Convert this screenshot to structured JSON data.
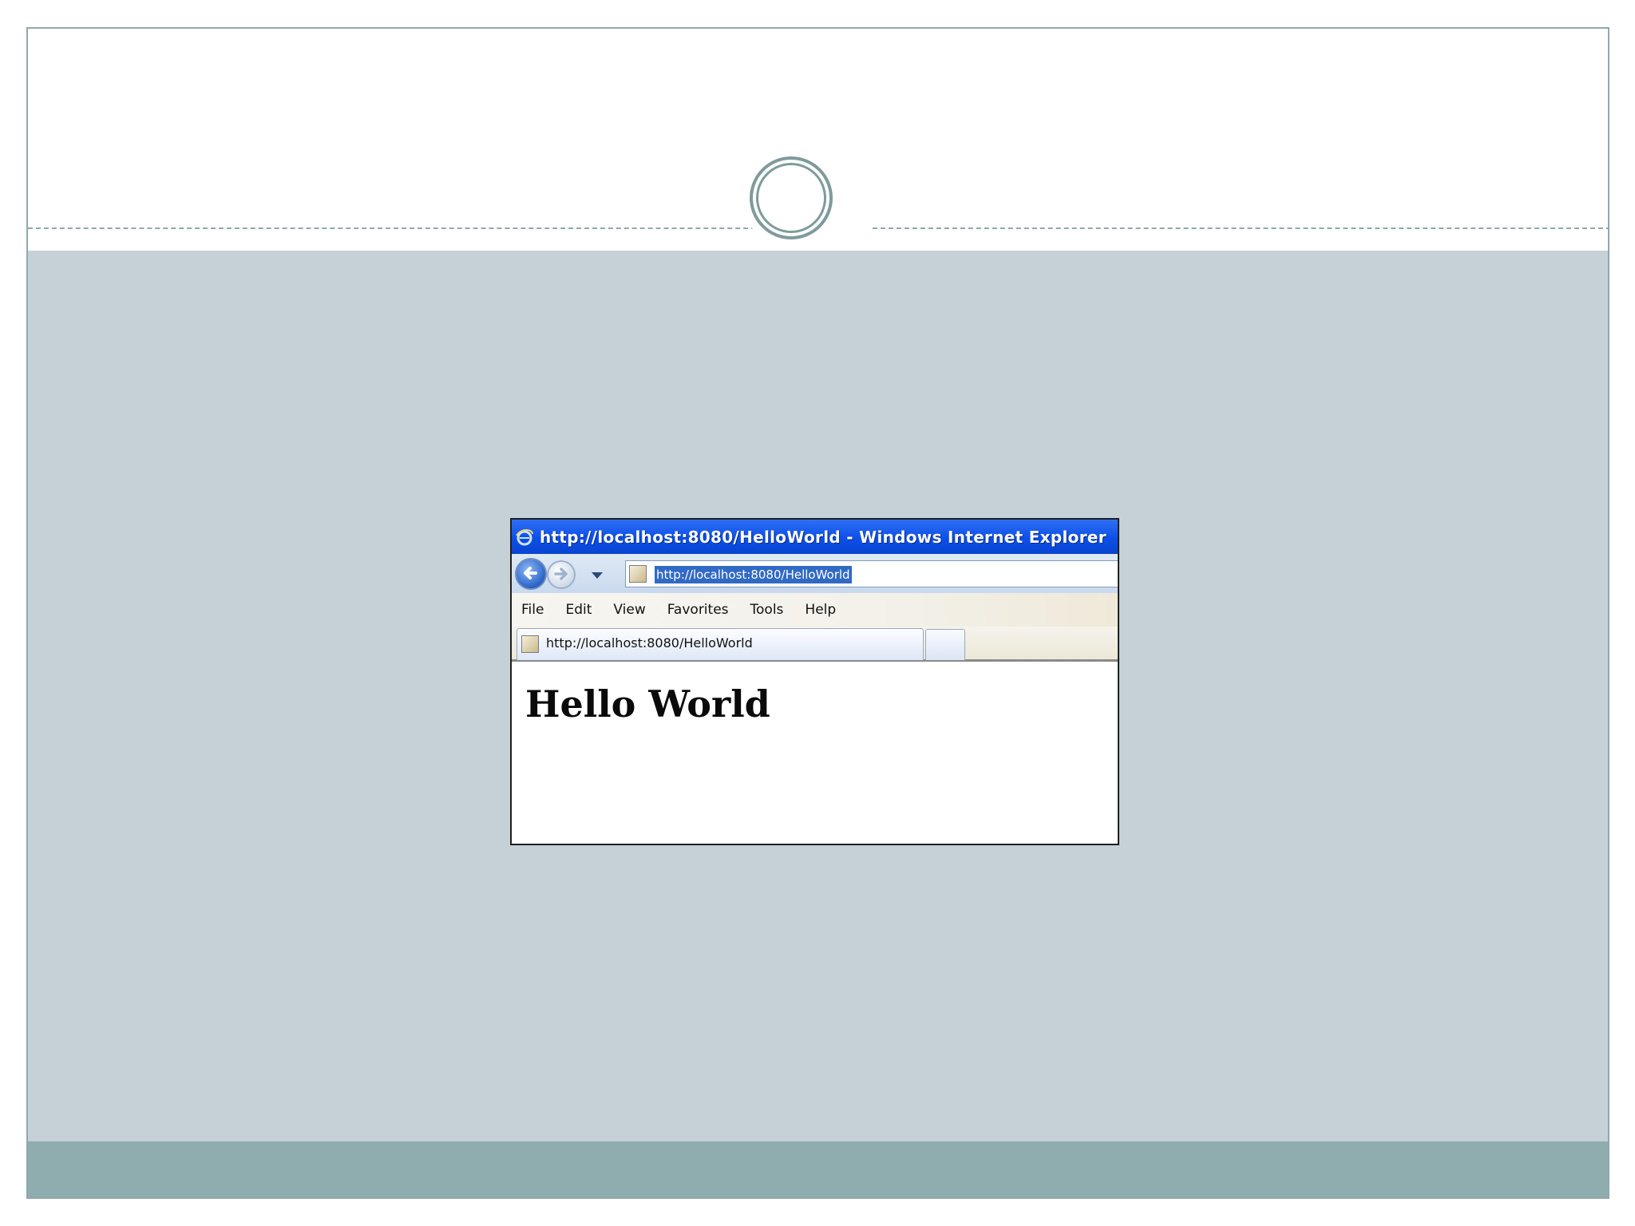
{
  "browser": {
    "title": "http://localhost:8080/HelloWorld - Windows Internet Explorer",
    "address": "http://localhost:8080/HelloWorld",
    "menu": [
      "File",
      "Edit",
      "View",
      "Favorites",
      "Tools",
      "Help"
    ],
    "tab_label": "http://localhost:8080/HelloWorld",
    "page_heading": "Hello World"
  },
  "colors": {
    "slide_body": "#c5d1d6",
    "slide_footer": "#8fadae",
    "slide_border": "#8fa9ac",
    "titlebar": "#0c4fe8",
    "address_selection": "#316ac5"
  },
  "icons": {
    "browser_icon": "ie-icon",
    "page_icon": "page-icon"
  }
}
